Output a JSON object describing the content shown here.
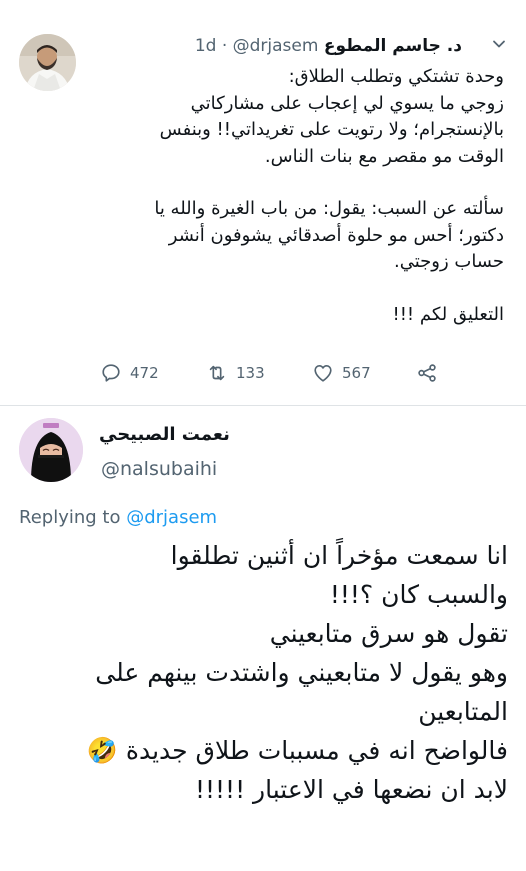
{
  "tweet": {
    "author_name": "د. جاسم المطوع",
    "author_handle": "@drjasem",
    "time_separator": "·",
    "time": "1d",
    "body_lines": [
      "وحدة تشتكي وتطلب الطلاق:",
      "زوجي ما يسوي لي إعجاب على مشاركاتي",
      "بالإنستجرام؛ ولا رتويت على تغريداتي!! وبنفس",
      "الوقت مو مقصر مع بنات الناس.",
      "",
      "سألته عن السبب: يقول: من باب الغيرة والله يا",
      "دكتور؛ أحس مو حلوة أصدقائي يشوفون أنشر",
      "حساب زوجتي.",
      "",
      "التعليق لكم !!!"
    ],
    "reply_count": "472",
    "retweet_count": "133",
    "like_count": "567",
    "icons": {
      "more": "chevron-down-icon",
      "reply": "reply-icon",
      "retweet": "retweet-icon",
      "like": "heart-icon",
      "share": "share-icon"
    }
  },
  "reply": {
    "author_name": "نعمت الصبيحي",
    "author_handle": "@nalsubaihi",
    "replying_prefix": "Replying to",
    "replying_to": "@drjasem",
    "body_lines": [
      "انا سمعت مؤخراً ان أثنين تطلقوا",
      "والسبب كان ؟!!!",
      "تقول هو سرق متابعيني",
      "وهو يقول لا متابعيني واشتدت بينهم على",
      "المتابعين",
      "فالواضح انه في مسببات طلاق جديدة 🤣",
      "لابد ان نضعها في الاعتبار !!!!!"
    ]
  },
  "colors": {
    "text": "#0f1419",
    "secondary": "#536471",
    "link": "#1d9bf0",
    "divider": "#dfe3e6"
  }
}
